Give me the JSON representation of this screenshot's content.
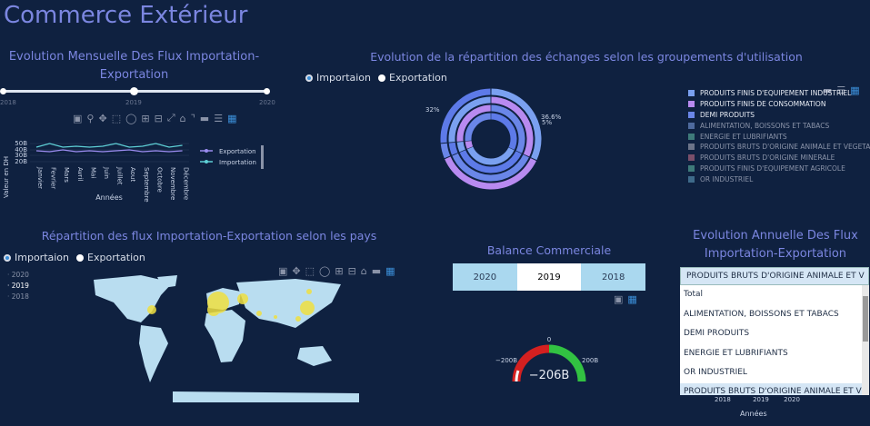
{
  "page_title": "Commerce Extérieur",
  "monthly": {
    "title_l1": "Evolution Mensuelle Des Flux Importation-",
    "title_l2": "Exportation",
    "slider": {
      "min": "2018",
      "mid": "2019",
      "max": "2020",
      "value": "2019"
    },
    "ylabel": "Valeur en DH",
    "xlabel": "Années",
    "yticks": [
      "50B",
      "40B",
      "30B",
      "20B"
    ],
    "months": [
      "Janvier",
      "Fevrier",
      "Mars",
      "Avril",
      "Mai",
      "Juin",
      "Juillet",
      "Aout",
      "Septembre",
      "Octobre",
      "Novembre",
      "Décembre"
    ],
    "legend": [
      "Exportation",
      "Importation"
    ]
  },
  "groups": {
    "title": "Evolution de la répartition des échanges selon les groupements d'utilisation",
    "radios": [
      "Importaion",
      "Exportation"
    ],
    "label_left": "32%",
    "label_right": "36.6%",
    "label_right2": "5%",
    "legend": [
      {
        "label": "PRODUITS FINIS D'EQUIPEMENT INDUSTRIEL",
        "color": "#7aa0f0",
        "active": true
      },
      {
        "label": "PRODUITS FINIS DE CONSOMMATION",
        "color": "#b88af0",
        "active": true
      },
      {
        "label": "DEMI  PRODUITS",
        "color": "#6a86e8",
        "active": true
      },
      {
        "label": "ALIMENTATION, BOISSONS ET TABACS",
        "color": "#4e6a9e",
        "active": false
      },
      {
        "label": "ENERGIE  ET  LUBRIFIANTS",
        "color": "#3e7a7a",
        "active": false
      },
      {
        "label": "PRODUITS BRUTS D'ORIGINE ANIMALE ET VEGETALE",
        "color": "#6c7489",
        "active": false
      },
      {
        "label": "PRODUITS BRUTS D'ORIGINE MINERALE",
        "color": "#7a4f6a",
        "active": false
      },
      {
        "label": "PRODUITS FINIS D'EQUIPEMENT AGRICOLE",
        "color": "#3e7a7a",
        "active": false
      },
      {
        "label": "OR INDUSTRIEL",
        "color": "#3e6a8a",
        "active": false
      }
    ],
    "rings": [
      0.32,
      0.366,
      0.05,
      0.264
    ]
  },
  "countries": {
    "title": "Répartition des flux Importation-Exportation selon les pays",
    "radios": [
      "Importaion",
      "Exportation"
    ],
    "years": [
      "2020",
      "2019",
      "2018"
    ]
  },
  "balance": {
    "title": "Balance Commerciale",
    "tabs": [
      "2020",
      "2019",
      "2018"
    ],
    "selected_tab": "2019",
    "gauge_value": "−206B",
    "gauge_min": "−200B",
    "gauge_max": "200B",
    "gauge_zero": "0"
  },
  "annual": {
    "title_l1": "Evolution Annuelle Des Flux",
    "title_l2": "Importation-Exportation",
    "dropdown_value": "PRODUITS BRUTS D'ORIGINE ANIMALE ET V",
    "options": [
      "Total",
      "ALIMENTATION, BOISSONS ET TABACS",
      "DEMI PRODUITS",
      "ENERGIE ET LUBRIFIANTS",
      "OR INDUSTRIEL",
      "PRODUITS BRUTS D'ORIGINE ANIMALE ET VEGETALE"
    ],
    "xticks": [
      "2018",
      "2019",
      "2020"
    ],
    "xlabel": "Années"
  }
}
